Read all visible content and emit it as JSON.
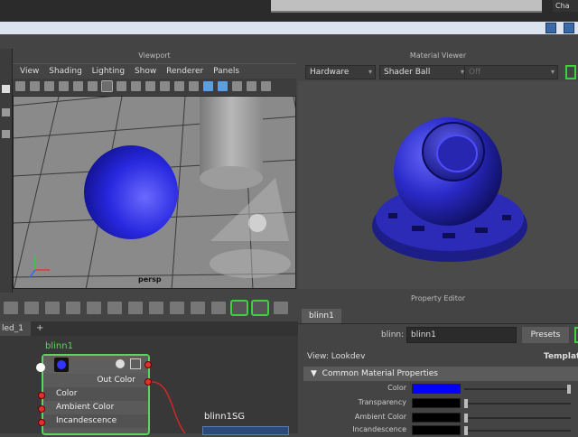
{
  "top": {
    "chapter_tab": "Cha"
  },
  "viewport": {
    "title": "Viewport",
    "menus": [
      "View",
      "Shading",
      "Lighting",
      "Show",
      "Renderer",
      "Panels"
    ],
    "camera_label": "persp"
  },
  "material_viewer": {
    "title": "Material Viewer",
    "renderer": "Hardware",
    "shape": "Shader Ball",
    "third": "Off"
  },
  "node_editor": {
    "tab_label": "led_1",
    "add_tab": "+",
    "node_name": "blinn1",
    "out_label": "Out Color",
    "attrs": [
      "Color",
      "Ambient Color",
      "Incandescence"
    ],
    "sg_node": "blinn1SG"
  },
  "property_editor": {
    "title": "Property Editor",
    "tab": "blinn1",
    "name_label": "blinn:",
    "name_value": "blinn1",
    "presets_label": "Presets",
    "view_label": "View: Lookdev",
    "templates_label": "Template",
    "section_title": "Common Material Properties",
    "attributes": [
      {
        "label": "Color",
        "swatch": "#0000ff",
        "slider": 1.0
      },
      {
        "label": "Transparency",
        "swatch": "#000000",
        "slider": 0.0
      },
      {
        "label": "Ambient Color",
        "swatch": "#000000",
        "slider": 0.0
      },
      {
        "label": "Incandescence",
        "swatch": "#000000",
        "slider": 0.0
      }
    ]
  }
}
